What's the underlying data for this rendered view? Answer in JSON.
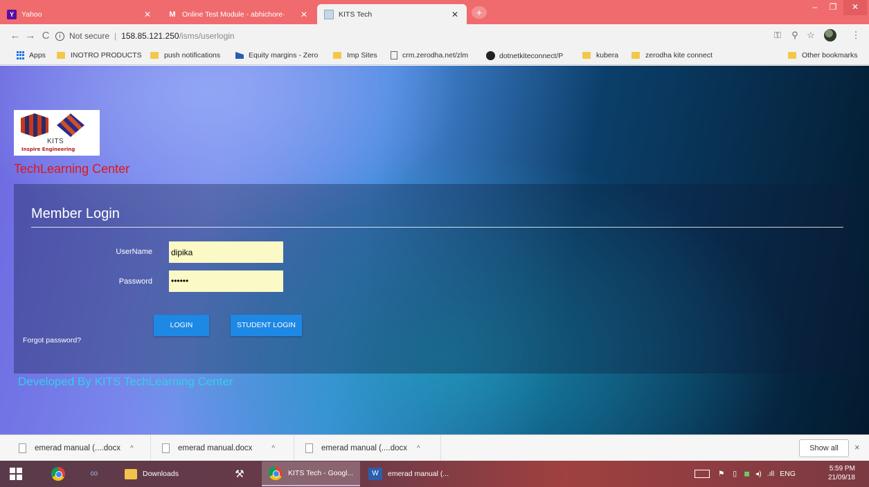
{
  "browser": {
    "tabs": [
      {
        "label": "Yahoo",
        "icon": "yahoo-icon",
        "active": false
      },
      {
        "label": "Online Test Module - abhichore·",
        "icon": "gmail-icon",
        "active": false
      },
      {
        "label": "KITS Tech",
        "icon": "page-icon",
        "active": true
      }
    ],
    "new_tab_label": "+",
    "address": {
      "security": "Not secure",
      "separator": "|",
      "host": "158.85.121.250",
      "path": "/isms/userlogin"
    },
    "bookmarks": [
      {
        "label": "Apps",
        "icon": "apps-grid-icon"
      },
      {
        "label": "INOTRO PRODUCTS",
        "icon": "folder-icon"
      },
      {
        "label": "push notifications",
        "icon": "folder-icon"
      },
      {
        "label": "Equity margins - Zero",
        "icon": "bookmark-flag-icon"
      },
      {
        "label": "Imp Sites",
        "icon": "folder-icon"
      },
      {
        "label": "crm.zerodha.net/zlm",
        "icon": "page-icon"
      },
      {
        "label": "dotnetkiteconnect/P",
        "icon": "github-icon"
      },
      {
        "label": "kubera",
        "icon": "folder-icon"
      },
      {
        "label": "zerodha kite connect",
        "icon": "folder-icon"
      },
      {
        "label": "Other bookmarks",
        "icon": "folder-icon"
      }
    ]
  },
  "site": {
    "logo_text": "KITS",
    "logo_tagline": "Inspire Engineering",
    "center_title": "TechLearning Center",
    "login": {
      "heading": "Member Login",
      "username_label": "UserName",
      "username_value": "dipika",
      "password_label": "Password",
      "password_value": "••••••",
      "login_button": "LOGIN",
      "student_login_button": "STUDENT LOGIN",
      "forgot_link": "Forgot password?"
    },
    "footer_credit": "Developed By KITS TechLearning Center"
  },
  "downloads": {
    "items": [
      {
        "label": "emerad manual (....docx",
        "icon": "doc-icon"
      },
      {
        "label": "emerad manual.docx",
        "icon": "doc-icon"
      },
      {
        "label": "emerad manual (....docx",
        "icon": "doc-icon"
      }
    ],
    "show_all": "Show all",
    "close": "×"
  },
  "taskbar": {
    "apps": [
      {
        "label": "Downloads",
        "icon": "folder-icon"
      },
      {
        "label": "KITS Tech - Googl...",
        "icon": "chrome-icon"
      },
      {
        "label": "emerad manual (...",
        "icon": "word-icon"
      }
    ],
    "language": "ENG",
    "time": "5:59 PM",
    "date": "21/09/18"
  },
  "colors": {
    "tabstrip": "#f06b6e",
    "center_title": "#e0161c",
    "button": "#1e88e5",
    "input_bg": "#fbf9c6",
    "footer_credit": "#2fd0e8"
  }
}
